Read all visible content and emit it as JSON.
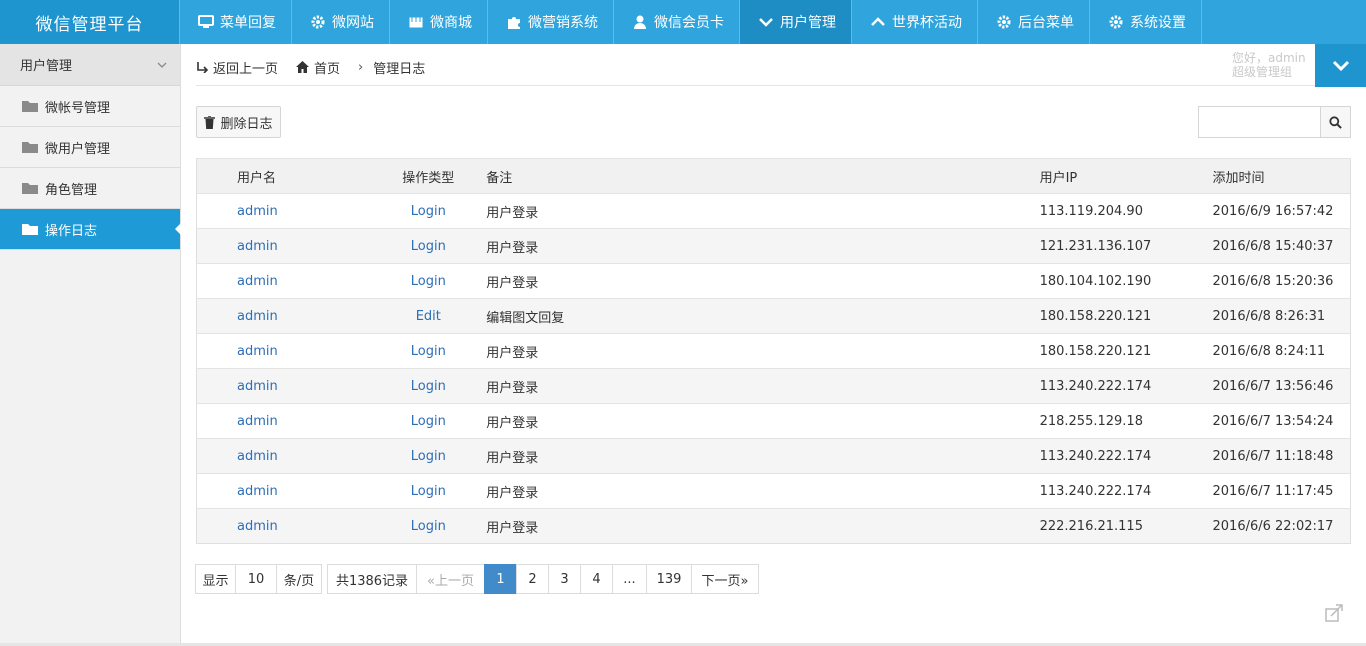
{
  "app": {
    "title": "微信管理平台"
  },
  "nav": [
    {
      "label": "菜单回复",
      "icon": "monitor-icon"
    },
    {
      "label": "微网站",
      "icon": "gear-icon"
    },
    {
      "label": "微商城",
      "icon": "store-icon"
    },
    {
      "label": "微营销系统",
      "icon": "puzzle-icon"
    },
    {
      "label": "微信会员卡",
      "icon": "user-icon"
    },
    {
      "label": "用户管理",
      "icon": "chevron-down-icon",
      "active": true
    },
    {
      "label": "世界杯活动",
      "icon": "chevron-up-icon"
    },
    {
      "label": "后台菜单",
      "icon": "gear-icon"
    },
    {
      "label": "系统设置",
      "icon": "gear-icon"
    }
  ],
  "sidebar": {
    "header": "用户管理",
    "items": [
      {
        "label": "微帐号管理"
      },
      {
        "label": "微用户管理"
      },
      {
        "label": "角色管理"
      },
      {
        "label": "操作日志",
        "active": true
      }
    ]
  },
  "breadcrumb": {
    "back": "返回上一页",
    "home": "首页",
    "current": "管理日志"
  },
  "greeting": {
    "line1": "您好，admin",
    "line2": "超级管理组"
  },
  "toolbar": {
    "delete_label": "删除日志",
    "search_placeholder": ""
  },
  "table": {
    "headers": [
      "用户名",
      "操作类型",
      "备注",
      "用户IP",
      "添加时间"
    ],
    "rows": [
      [
        "admin",
        "Login",
        "用户登录",
        "113.119.204.90",
        "2016/6/9 16:57:42"
      ],
      [
        "admin",
        "Login",
        "用户登录",
        "121.231.136.107",
        "2016/6/8 15:40:37"
      ],
      [
        "admin",
        "Login",
        "用户登录",
        "180.104.102.190",
        "2016/6/8 15:20:36"
      ],
      [
        "admin",
        "Edit",
        "编辑图文回复",
        "180.158.220.121",
        "2016/6/8 8:26:31"
      ],
      [
        "admin",
        "Login",
        "用户登录",
        "180.158.220.121",
        "2016/6/8 8:24:11"
      ],
      [
        "admin",
        "Login",
        "用户登录",
        "113.240.222.174",
        "2016/6/7 13:56:46"
      ],
      [
        "admin",
        "Login",
        "用户登录",
        "218.255.129.18",
        "2016/6/7 13:54:24"
      ],
      [
        "admin",
        "Login",
        "用户登录",
        "113.240.222.174",
        "2016/6/7 11:18:48"
      ],
      [
        "admin",
        "Login",
        "用户登录",
        "113.240.222.174",
        "2016/6/7 11:17:45"
      ],
      [
        "admin",
        "Login",
        "用户登录",
        "222.216.21.115",
        "2016/6/6 22:02:17"
      ]
    ]
  },
  "pager": {
    "show": "显示",
    "page_size": "10",
    "per_page": "条/页",
    "total": "共1386记录",
    "prev": "«上一页",
    "pages": [
      "1",
      "2",
      "3",
      "4",
      "...",
      "139"
    ],
    "current": "1",
    "next": "下一页»"
  }
}
